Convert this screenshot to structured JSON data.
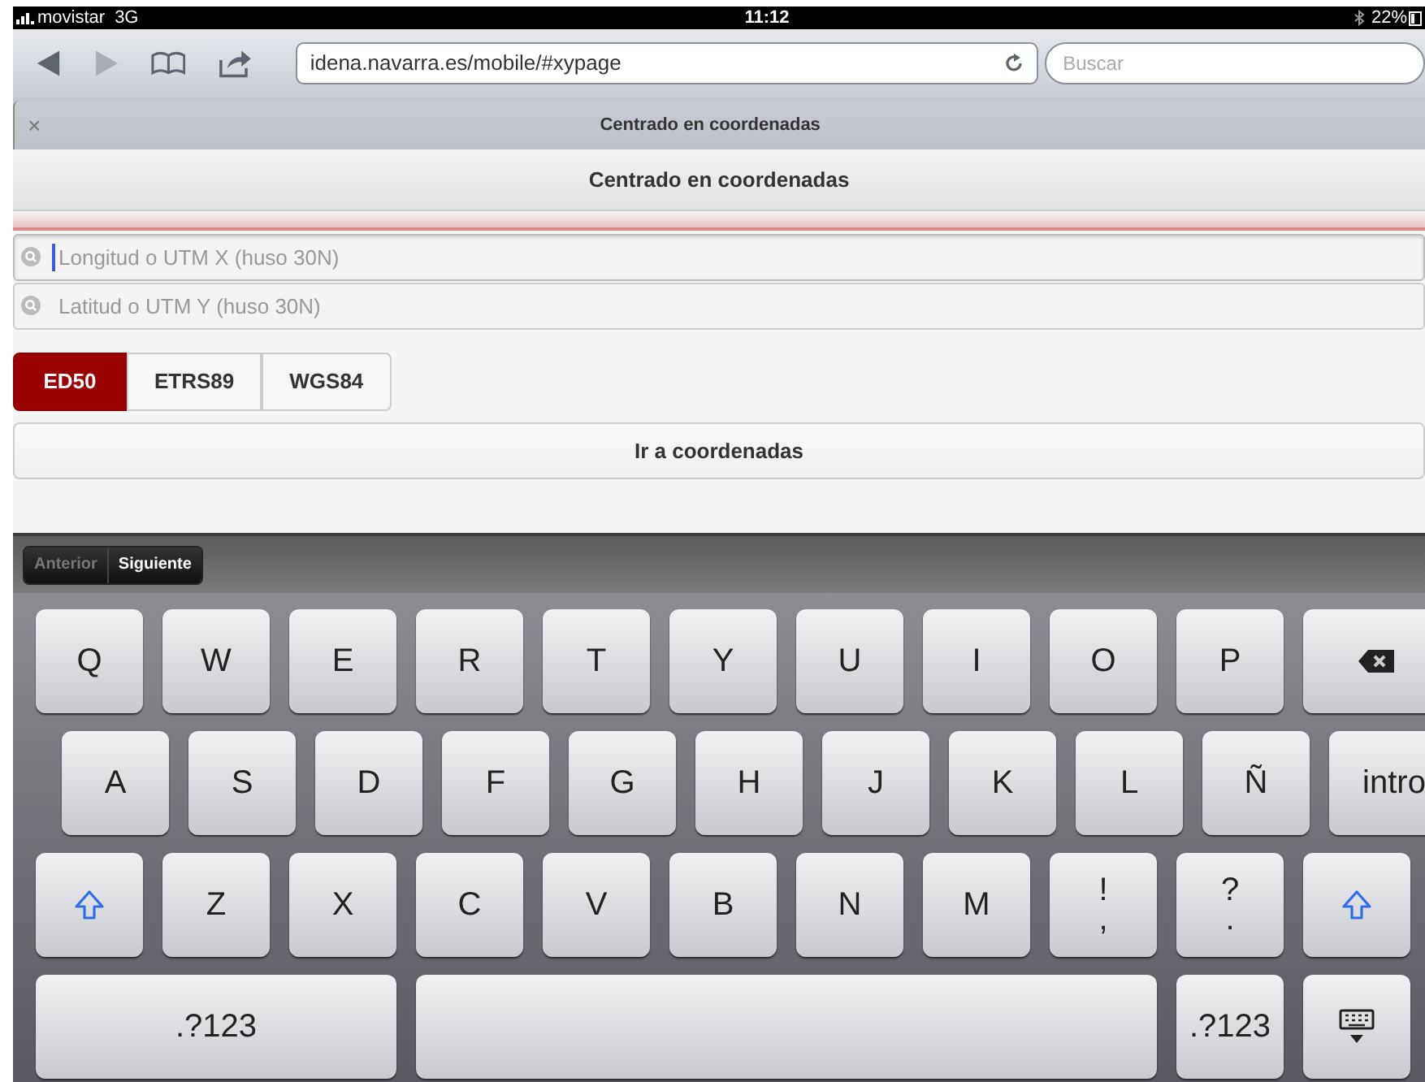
{
  "status_bar": {
    "carrier": "movistar",
    "network": "3G",
    "time": "11:12",
    "battery": "22%"
  },
  "browser": {
    "url": "idena.navarra.es/mobile/#xypage",
    "search_placeholder": "Buscar",
    "tab_title": "Centrado en coordenadas",
    "tab_close": "×"
  },
  "page": {
    "title": "Centrado en coordenadas",
    "fields": [
      {
        "placeholder": "Longitud o UTM X (huso 30N)",
        "focused": true
      },
      {
        "placeholder": "Latitud o UTM Y (huso 30N)",
        "focused": false
      }
    ],
    "datums": [
      {
        "label": "ED50",
        "selected": true
      },
      {
        "label": "ETRS89",
        "selected": false
      },
      {
        "label": "WGS84",
        "selected": false
      }
    ],
    "go_button": "Ir a coordenadas"
  },
  "form_nav": [
    {
      "label": "Anterior",
      "disabled": true
    },
    {
      "label": "Siguiente",
      "disabled": false
    }
  ],
  "keyboard": {
    "rows": [
      {
        "keys": [
          {
            "kind": "letter",
            "label": "Q"
          },
          {
            "kind": "letter",
            "label": "W"
          },
          {
            "kind": "letter",
            "label": "E"
          },
          {
            "kind": "letter",
            "label": "R"
          },
          {
            "kind": "letter",
            "label": "T"
          },
          {
            "kind": "letter",
            "label": "Y"
          },
          {
            "kind": "letter",
            "label": "U"
          },
          {
            "kind": "letter",
            "label": "I"
          },
          {
            "kind": "letter",
            "label": "O"
          },
          {
            "kind": "letter",
            "label": "P"
          },
          {
            "kind": "backspace"
          }
        ]
      },
      {
        "keys": [
          {
            "kind": "letter",
            "label": "A"
          },
          {
            "kind": "letter",
            "label": "S"
          },
          {
            "kind": "letter",
            "label": "D"
          },
          {
            "kind": "letter",
            "label": "F"
          },
          {
            "kind": "letter",
            "label": "G"
          },
          {
            "kind": "letter",
            "label": "H"
          },
          {
            "kind": "letter",
            "label": "J"
          },
          {
            "kind": "letter",
            "label": "K"
          },
          {
            "kind": "letter",
            "label": "L"
          },
          {
            "kind": "letter",
            "label": "Ñ"
          },
          {
            "kind": "return",
            "label": "intro"
          }
        ]
      },
      {
        "keys": [
          {
            "kind": "shift"
          },
          {
            "kind": "letter",
            "label": "Z"
          },
          {
            "kind": "letter",
            "label": "X"
          },
          {
            "kind": "letter",
            "label": "C"
          },
          {
            "kind": "letter",
            "label": "V"
          },
          {
            "kind": "letter",
            "label": "B"
          },
          {
            "kind": "letter",
            "label": "N"
          },
          {
            "kind": "letter",
            "label": "M"
          },
          {
            "kind": "dual",
            "label": "!",
            "sub": ","
          },
          {
            "kind": "dual",
            "label": "?",
            "sub": "."
          },
          {
            "kind": "shift"
          }
        ]
      },
      {
        "keys": [
          {
            "kind": "symbols",
            "label": ".?123"
          },
          {
            "kind": "space"
          },
          {
            "kind": "symbols_small",
            "label": ".?123"
          },
          {
            "kind": "hide"
          }
        ]
      }
    ]
  }
}
